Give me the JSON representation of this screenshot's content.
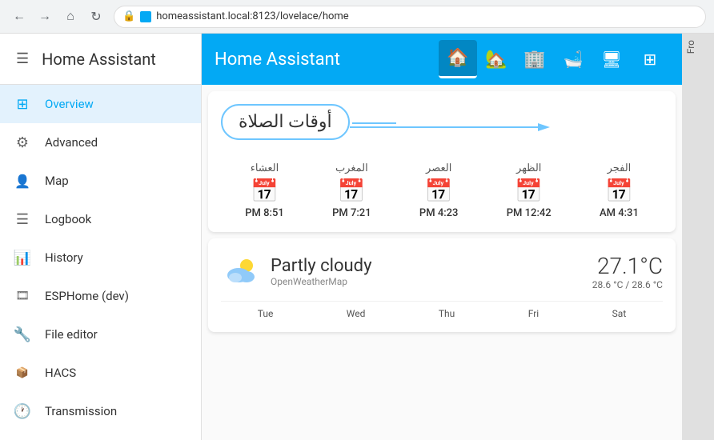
{
  "browser": {
    "url": "homeassistant.local:8123/lovelace/home",
    "back_title": "back",
    "forward_title": "forward",
    "home_title": "home",
    "refresh_title": "refresh"
  },
  "sidebar": {
    "title": "Home Assistant",
    "hamburger_label": "menu",
    "items": [
      {
        "id": "overview",
        "label": "Overview",
        "icon": "⊞",
        "active": true
      },
      {
        "id": "advanced",
        "label": "Advanced",
        "icon": "⚙",
        "active": false
      },
      {
        "id": "map",
        "label": "Map",
        "icon": "👤",
        "active": false
      },
      {
        "id": "logbook",
        "label": "Logbook",
        "icon": "≡",
        "active": false
      },
      {
        "id": "history",
        "label": "History",
        "icon": "📊",
        "active": false
      },
      {
        "id": "esphome",
        "label": "ESPHome (dev)",
        "icon": "🎞",
        "active": false
      },
      {
        "id": "file-editor",
        "label": "File editor",
        "icon": "🔧",
        "active": false
      },
      {
        "id": "hacs",
        "label": "HACS",
        "icon": "📦",
        "active": false
      },
      {
        "id": "transmission",
        "label": "Transmission",
        "icon": "🕐",
        "active": false
      }
    ]
  },
  "topbar": {
    "title": "Home Assistant",
    "tabs": [
      {
        "icon": "🏠",
        "label": "home",
        "active": true
      },
      {
        "icon": "🏡",
        "label": "outside"
      },
      {
        "icon": "🏢",
        "label": "building"
      },
      {
        "icon": "🛁",
        "label": "bath"
      },
      {
        "icon": "🖥",
        "label": "monitor"
      },
      {
        "icon": "⊞",
        "label": "network"
      }
    ]
  },
  "prayer_card": {
    "title": "أوقات الصلاة",
    "prayers": [
      {
        "name": "الفجر",
        "time": "4:31 AM"
      },
      {
        "name": "الظهر",
        "time": "12:42 PM"
      },
      {
        "name": "العصر",
        "time": "4:23 PM"
      },
      {
        "name": "المغرب",
        "time": "7:21 PM"
      },
      {
        "name": "العشاء",
        "time": "8:51 PM"
      }
    ]
  },
  "weather_card": {
    "condition": "Partly cloudy",
    "source": "OpenWeatherMap",
    "temperature": "27.1°C",
    "high_low": "28.6 °C / 28.6 °C",
    "days": [
      "Tue",
      "Wed",
      "Thu",
      "Fri",
      "Sat"
    ]
  },
  "right_panel": {
    "label": "Fro"
  }
}
